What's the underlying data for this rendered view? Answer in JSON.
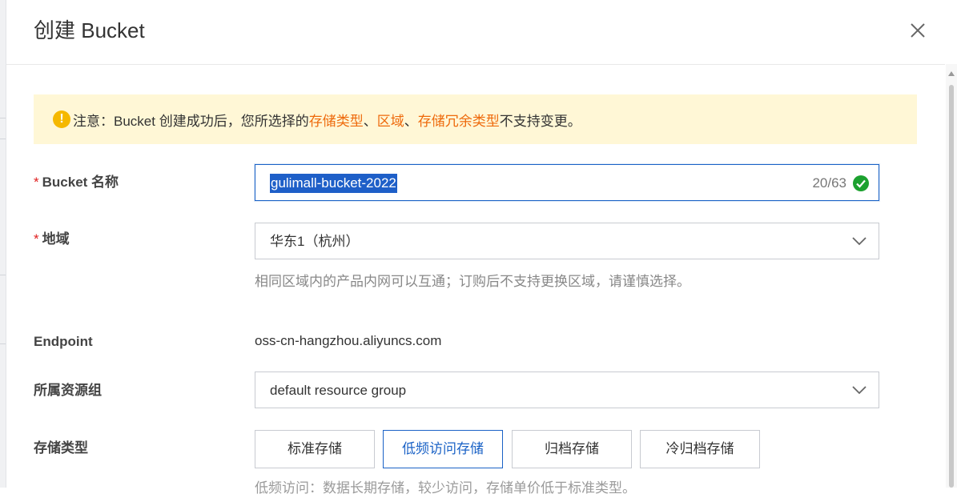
{
  "dialog": {
    "title": "创建 Bucket"
  },
  "notice": {
    "prefix": "注意：Bucket 创建成功后，您所选择的 ",
    "highlight_1": "存储类型",
    "sep_1": "、",
    "highlight_2": "区域",
    "sep_2": "、",
    "highlight_3": "存储冗余类型",
    "suffix": " 不支持变更。"
  },
  "bucket_name": {
    "required_mark": "*",
    "label": "Bucket 名称",
    "value": "gulimall-bucket-2022",
    "counter": "20/63"
  },
  "region": {
    "required_mark": "*",
    "label": "地域",
    "value": "华东1（杭州）",
    "help": "相同区域内的产品内网可以互通；订购后不支持更换区域，请谨慎选择。"
  },
  "endpoint": {
    "label": "Endpoint",
    "value": "oss-cn-hangzhou.aliyuncs.com"
  },
  "resource_group": {
    "label": "所属资源组",
    "value": "default resource group"
  },
  "storage_class": {
    "label": "存储类型",
    "options": [
      "标准存储",
      "低频访问存储",
      "归档存储",
      "冷归档存储"
    ],
    "selected_index": 1,
    "help_cut": "低频访问：数据长期存储，较少访问，存储单价低于标准类型。"
  },
  "colors": {
    "accent": "#1a62c6",
    "warning_bg": "#fff7d6",
    "highlight": "#ee6a0c",
    "success": "#1ca12f",
    "required": "#e02020"
  }
}
